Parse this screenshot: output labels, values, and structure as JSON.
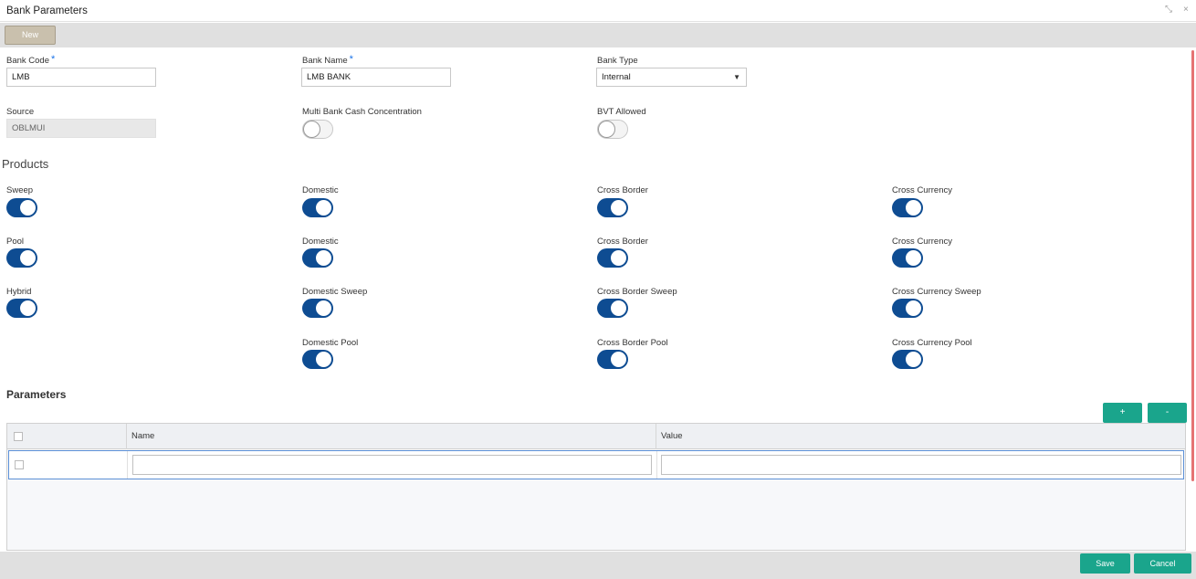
{
  "window": {
    "title": "Bank Parameters",
    "controls": {
      "minimize": "⤡",
      "close": "×"
    }
  },
  "toolbar": {
    "new_label": "New"
  },
  "fields": {
    "bank_code": {
      "label": "Bank Code",
      "required": "*",
      "value": "LMB"
    },
    "bank_name": {
      "label": "Bank Name",
      "required": "*",
      "value": "LMB BANK"
    },
    "bank_type": {
      "label": "Bank Type",
      "value": "Internal",
      "arrow": "▼"
    },
    "source": {
      "label": "Source",
      "value": "OBLMUI"
    },
    "multi_bank": {
      "label": "Multi Bank Cash Concentration",
      "state": "off"
    },
    "bvt_allowed": {
      "label": "BVT Allowed",
      "state": "off"
    }
  },
  "products": {
    "title": "Products",
    "sweep": "Sweep",
    "sweep_domestic": "Domestic",
    "sweep_cross_border": "Cross Border",
    "sweep_cross_currency": "Cross Currency",
    "pool": "Pool",
    "pool_domestic": "Domestic",
    "pool_cross_border": "Cross Border",
    "pool_cross_currency": "Cross Currency",
    "hybrid": "Hybrid",
    "domestic_sweep": "Domestic Sweep",
    "cross_border_sweep": "Cross Border Sweep",
    "cross_currency_sweep": "Cross Currency Sweep",
    "domestic_pool": "Domestic Pool",
    "cross_border_pool": "Cross Border Pool",
    "cross_currency_pool": "Cross Currency Pool",
    "all_state": "on"
  },
  "parameters": {
    "title": "Parameters",
    "add_label": "+",
    "remove_label": "-",
    "columns": [
      "Name",
      "Value"
    ]
  },
  "footer": {
    "save_label": "Save",
    "cancel_label": "Cancel"
  },
  "colors": {
    "toggle_on": "#0e4c92",
    "accent": "#1aa58c",
    "new_button": "#c9c0ad",
    "required": "#1a73e8"
  }
}
